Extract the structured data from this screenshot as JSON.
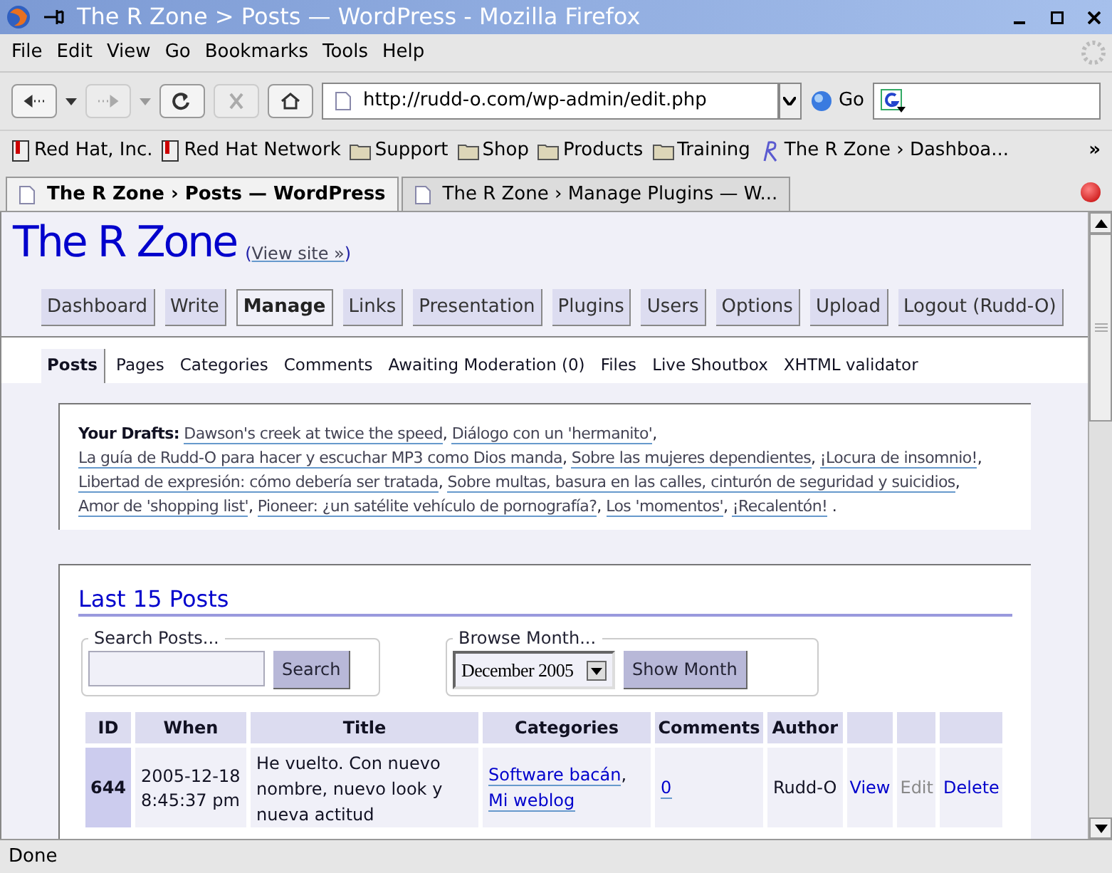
{
  "window": {
    "title": "The R Zone > Posts — WordPress - Mozilla Firefox"
  },
  "menu": [
    "File",
    "Edit",
    "View",
    "Go",
    "Bookmarks",
    "Tools",
    "Help"
  ],
  "toolbar": {
    "url": "http://rudd-o.com/wp-admin/edit.php",
    "go": "Go"
  },
  "bookmarks": [
    {
      "label": "Red Hat, Inc.",
      "kind": "page"
    },
    {
      "label": "Red Hat Network",
      "kind": "page"
    },
    {
      "label": "Support",
      "kind": "folder"
    },
    {
      "label": "Shop",
      "kind": "folder"
    },
    {
      "label": "Products",
      "kind": "folder"
    },
    {
      "label": "Training",
      "kind": "folder"
    },
    {
      "label": "The R Zone › Dashboa...",
      "kind": "site"
    }
  ],
  "bookmarks_more": "»",
  "tabs": [
    {
      "label": "The R Zone › Posts — WordPress",
      "selected": true
    },
    {
      "label": "The R Zone › Manage Plugins — W...",
      "selected": false
    }
  ],
  "site": {
    "title": "The R Zone",
    "open": "(",
    "view_site": "View site »",
    "close": ")"
  },
  "admin_menu": [
    {
      "label": "Dashboard",
      "selected": false
    },
    {
      "label": "Write",
      "selected": false
    },
    {
      "label": "Manage",
      "selected": true
    },
    {
      "label": "Links",
      "selected": false
    },
    {
      "label": "Presentation",
      "selected": false
    },
    {
      "label": "Plugins",
      "selected": false
    },
    {
      "label": "Users",
      "selected": false
    },
    {
      "label": "Options",
      "selected": false
    },
    {
      "label": "Upload",
      "selected": false
    },
    {
      "label": "Logout (Rudd-O)",
      "selected": false
    }
  ],
  "submenu": [
    {
      "label": "Posts",
      "selected": true
    },
    {
      "label": "Pages",
      "selected": false
    },
    {
      "label": "Categories",
      "selected": false
    },
    {
      "label": "Comments",
      "selected": false
    },
    {
      "label": "Awaiting Moderation (0)",
      "selected": false
    },
    {
      "label": "Files",
      "selected": false
    },
    {
      "label": "Live Shoutbox",
      "selected": false
    },
    {
      "label": "XHTML validator",
      "selected": false
    }
  ],
  "drafts": {
    "label": "Your Drafts:",
    "separator": ",",
    "end": ".",
    "items": [
      "Dawson's creek at twice the speed",
      "Diálogo con un 'hermanito'",
      "La guía de Rudd-O para hacer y escuchar MP3 como Dios manda",
      "Sobre las mujeres dependientes",
      "¡Locura de insomnio!",
      "Libertad de expresión: cómo debería ser tratada",
      "Sobre multas, basura en las calles, cinturón de seguridad y suicidios",
      "Amor de 'shopping list'",
      "Pioneer: ¿un satélite vehículo de pornografía?",
      "Los 'momentos'",
      "¡Recalentón!"
    ]
  },
  "posts": {
    "heading": "Last 15 Posts",
    "search": {
      "legend": "Search Posts...",
      "button": "Search"
    },
    "month": {
      "legend": "Browse Month...",
      "value": "December 2005",
      "button": "Show Month"
    },
    "columns": [
      "ID",
      "When",
      "Title",
      "Categories",
      "Comments",
      "Author"
    ],
    "rows": [
      {
        "id": "644",
        "when": "2005-12-18 8:45:37 pm",
        "title": "He vuelto. Con nuevo nombre, nuevo look y nueva actitud",
        "categories": [
          "Software bacán",
          "Mi weblog"
        ],
        "separator": ",",
        "comments": "0",
        "author": "Rudd-O",
        "actions": [
          {
            "label": "View",
            "disabled": false
          },
          {
            "label": "Edit",
            "disabled": true
          },
          {
            "label": "Delete",
            "disabled": false
          }
        ]
      }
    ]
  },
  "status": "Done"
}
